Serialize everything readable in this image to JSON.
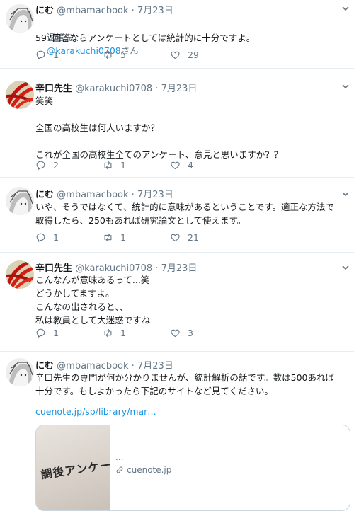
{
  "tweets": [
    {
      "name": "にむ",
      "handle": "@mbamacbook",
      "dot": "·",
      "date": "7月23日",
      "reply_label": "返信先:",
      "reply_mention": "@karakuchi0708",
      "reply_suffix": "さん",
      "text": "597回答ならアンケートとしては統計的に十分ですよ。",
      "replies": "1",
      "retweets": "5",
      "likes": "29"
    },
    {
      "name": "辛口先生",
      "handle": "@karakuchi0708",
      "dot": "·",
      "date": "7月23日",
      "text": "笑笑\n\n全国の高校生は何人いますか？\n\nこれが全国の高校生全てのアンケート、意見と思いますか？？",
      "replies": "2",
      "retweets": "1",
      "likes": "4"
    },
    {
      "name": "にむ",
      "handle": "@mbamacbook",
      "dot": "·",
      "date": "7月23日",
      "text": "いや、そうではなくて、統計的に意味があるということです。適正な方法で\n取得したら、250もあれば研究論文として使えます。",
      "replies": "1",
      "retweets": "1",
      "likes": "21"
    },
    {
      "name": "辛口先生",
      "handle": "@karakuchi0708",
      "dot": "·",
      "date": "7月23日",
      "text": "こんなんが意味あるって...笑\nどうかしてますよ。\nこんなの出されると、、\n私は教員として大迷惑ですね",
      "replies": "1",
      "retweets": "1",
      "likes": "3"
    },
    {
      "name": "にむ",
      "handle": "@mbamacbook",
      "dot": "·",
      "date": "7月23日",
      "text": "辛口先生の専門が何か分かりませんが、統計解析の話です。数は500あれば\n十分です。もしよかったら下記のサイトなど見てください。",
      "link": "cuenote.jp/sp/library/mar…",
      "card": {
        "image_text": "調後アンケート",
        "dots": "...",
        "domain": "cuenote.jp"
      }
    }
  ],
  "colors": {
    "link": "#1b95e0",
    "meta": "#657786",
    "divider": "#e6ecf0"
  },
  "icons": [
    "reply-icon",
    "retweet-icon",
    "like-icon",
    "chevron-down-icon",
    "link-icon"
  ]
}
